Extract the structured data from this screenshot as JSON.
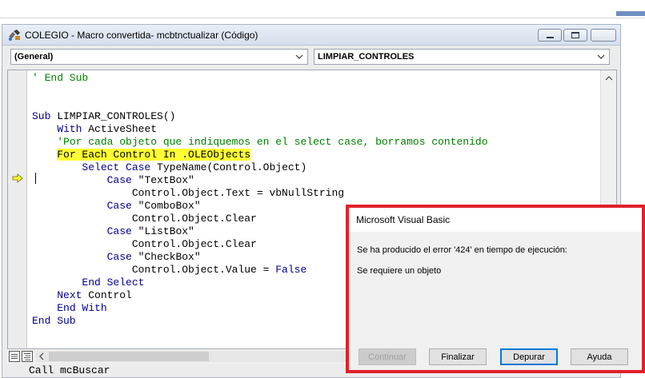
{
  "code_window": {
    "title": "COLEGIO - Macro convertida- mcbtnctualizar (Código)",
    "object_combo": "(General)",
    "procedure_combo": "LIMPIAR_CONTROLES"
  },
  "code_lines": [
    [
      {
        "t": "' End Sub",
        "c": "cm"
      }
    ],
    [],
    [],
    [
      {
        "t": "Sub",
        "c": "kw"
      },
      {
        "t": " LIMPIAR_CONTROLES()"
      }
    ],
    [
      {
        "t": "    "
      },
      {
        "t": "With",
        "c": "kw"
      },
      {
        "t": " ActiveSheet"
      }
    ],
    [
      {
        "t": "    "
      },
      {
        "t": "'Por cada objeto que indiquemos en el select case, borramos contenido",
        "c": "cm"
      }
    ],
    [
      {
        "t": "    "
      },
      {
        "t": "For Each Control In .OLEObjects",
        "c": "hl"
      }
    ],
    [
      {
        "t": "        "
      },
      {
        "t": "Select Case",
        "c": "kw"
      },
      {
        "t": " TypeName(Control.Object)"
      }
    ],
    [
      {
        "t": "            "
      },
      {
        "t": "Case",
        "c": "kw"
      },
      {
        "t": " \"TextBox\""
      }
    ],
    [
      {
        "t": "                Control.Object.Text = vbNullString"
      }
    ],
    [
      {
        "t": "            "
      },
      {
        "t": "Case",
        "c": "kw"
      },
      {
        "t": " \"ComboBox\""
      }
    ],
    [
      {
        "t": "                Control.Object.Clear"
      }
    ],
    [
      {
        "t": "            "
      },
      {
        "t": "Case",
        "c": "kw"
      },
      {
        "t": " \"ListBox\""
      }
    ],
    [
      {
        "t": "                Control.Object.Clear"
      }
    ],
    [
      {
        "t": "            "
      },
      {
        "t": "Case",
        "c": "kw"
      },
      {
        "t": " \"CheckBox\""
      }
    ],
    [
      {
        "t": "                Control.Object.Value = "
      },
      {
        "t": "False",
        "c": "kw"
      }
    ],
    [
      {
        "t": "        "
      },
      {
        "t": "End Select",
        "c": "kw"
      }
    ],
    [
      {
        "t": "    "
      },
      {
        "t": "Next",
        "c": "kw"
      },
      {
        "t": " Control"
      }
    ],
    [
      {
        "t": "    "
      },
      {
        "t": "End With",
        "c": "kw"
      }
    ],
    [
      {
        "t": "End Sub",
        "c": "kw"
      }
    ]
  ],
  "below_code_text": "Call mcBuscar",
  "dialog": {
    "title": "Microsoft Visual Basic",
    "message": "Se ha producido el error '424' en tiempo de ejecución:",
    "detail": "Se requiere un objeto",
    "buttons": {
      "continue": "Continuar",
      "end": "Finalizar",
      "debug": "Depurar",
      "help": "Ayuda"
    }
  },
  "colors": {
    "keyword": "#00008b",
    "comment": "#008000",
    "highlight": "#ffff33",
    "dialog_outline": "#e0202a",
    "default_button_border": "#0078d7"
  },
  "icons": [
    "vba-module-icon",
    "minimize-icon",
    "maximize-icon",
    "dropdown-arrow-icon",
    "execution-arrow-icon",
    "scroll-up-icon",
    "scroll-left-icon",
    "procedure-view-icon",
    "full-module-view-icon"
  ]
}
